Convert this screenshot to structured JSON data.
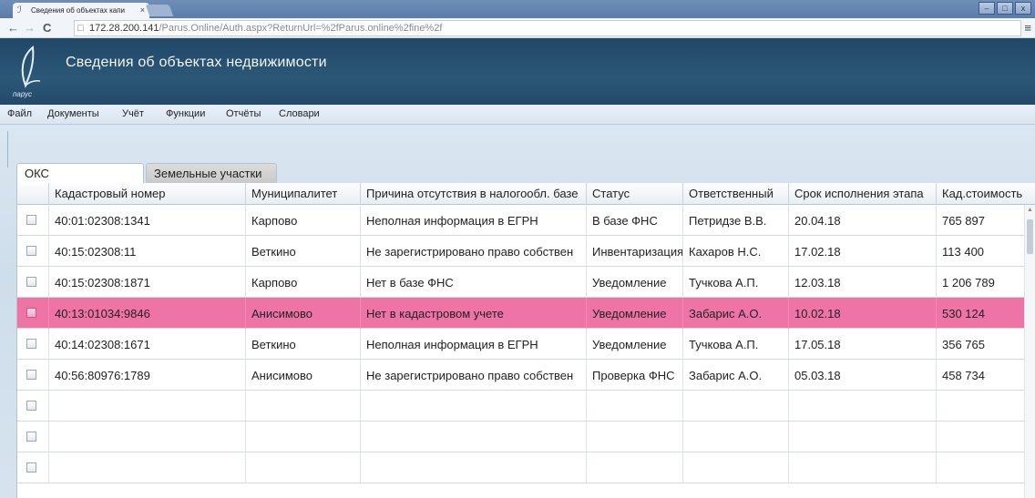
{
  "browser": {
    "tab_title": "Сведения об объектах капи",
    "tab_close": "×",
    "url_main": "172.28.200.141",
    "url_rest": "/Parus.Online/Auth.aspx?ReturnUrl=%2fParus.online%2fine%2f",
    "window_controls": [
      "–",
      "□",
      "x"
    ]
  },
  "app": {
    "logo_text": "парус",
    "title": "Сведения об объектах  недвижимости"
  },
  "menu": [
    "Файл",
    "Документы",
    "Учёт",
    "Функции",
    "Отчёты",
    "Словари"
  ],
  "tabs": [
    "ОКС",
    "Земельные участки"
  ],
  "table": {
    "columns": [
      "Кадастровый номер",
      "Муниципалитет",
      "Причина отсутствия в налогообл. базе",
      "Статус",
      "Ответственный",
      "Срок исполнения этапа",
      "Кад.стоимость"
    ],
    "rows": [
      [
        "40:01:02308:1341",
        "Карпово",
        "Неполная информация в ЕГРН",
        "В базе ФНС",
        "Петридзе В.В.",
        "20.04.18",
        "765 897"
      ],
      [
        "40:15:02308:11",
        "Веткино",
        "Не зарегистрировано право собствен",
        "Инвентаризация",
        "Кахаров Н.С.",
        "17.02.18",
        "113 400"
      ],
      [
        "40:15:02308:1871",
        "Карпово",
        "Нет в базе ФНС",
        "Уведомление",
        "Тучкова А.П.",
        "12.03.18",
        "1 206 789"
      ],
      [
        "40:13:01034:9846",
        "Анисимово",
        "Нет в кадастровом учете",
        "Уведомление",
        "Забарис А.О.",
        "10.02.18",
        "530 124"
      ],
      [
        "40:14:02308:1671",
        "Веткино",
        "Неполная информация в ЕГРН",
        "Уведомление",
        "Тучкова А.П.",
        "17.05.18",
        "356 765"
      ],
      [
        "40:56:80976:1789",
        "Анисимово",
        "Не зарегистрировано право собствен",
        "Проверка ФНС",
        "Забарис А.О.",
        "05.03.18",
        "458 734"
      ],
      [
        "",
        "",
        "",
        "",
        "",
        "",
        ""
      ],
      [
        "",
        "",
        "",
        "",
        "",
        "",
        ""
      ],
      [
        "",
        "",
        "",
        "",
        "",
        "",
        ""
      ]
    ],
    "selected_row_index": 3
  },
  "colors": {
    "header_bg": "#24496a",
    "selected_row": "#ef74a6",
    "workspace_bg": "#d6e3ef"
  }
}
